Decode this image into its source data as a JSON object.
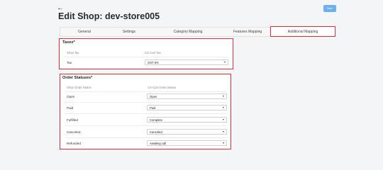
{
  "header": {
    "back_icon": "arrow-left-icon",
    "title": "Edit Shop: dev-store005",
    "save_label": "Save"
  },
  "tabs": [
    {
      "label": "General"
    },
    {
      "label": "Settings"
    },
    {
      "label": "Category Mapping"
    },
    {
      "label": "Features Mapping"
    },
    {
      "label": "Additional Mapping",
      "active": true
    }
  ],
  "taxes": {
    "title": "Taxes",
    "required_mark": "*",
    "col_left": "Shop Tax",
    "col_right": "CS-Cart Tax",
    "rows": [
      {
        "label": "Tax",
        "value": "GST 5%"
      }
    ]
  },
  "statuses": {
    "title": "Order Statuses",
    "required_mark": "*",
    "col_left": "Shop Order Status",
    "col_right": "CS-Cart Order Status",
    "rows": [
      {
        "label": "Open",
        "value": "Open"
      },
      {
        "label": "Paid",
        "value": "Paid"
      },
      {
        "label": "Fulfilled",
        "value": "Complete"
      },
      {
        "label": "Canceled",
        "value": "Canceled"
      },
      {
        "label": "Refunded",
        "value": "Awaiting call"
      }
    ]
  },
  "colors": {
    "highlight": "#e32d3c",
    "save_button": "#6ab1ee"
  }
}
